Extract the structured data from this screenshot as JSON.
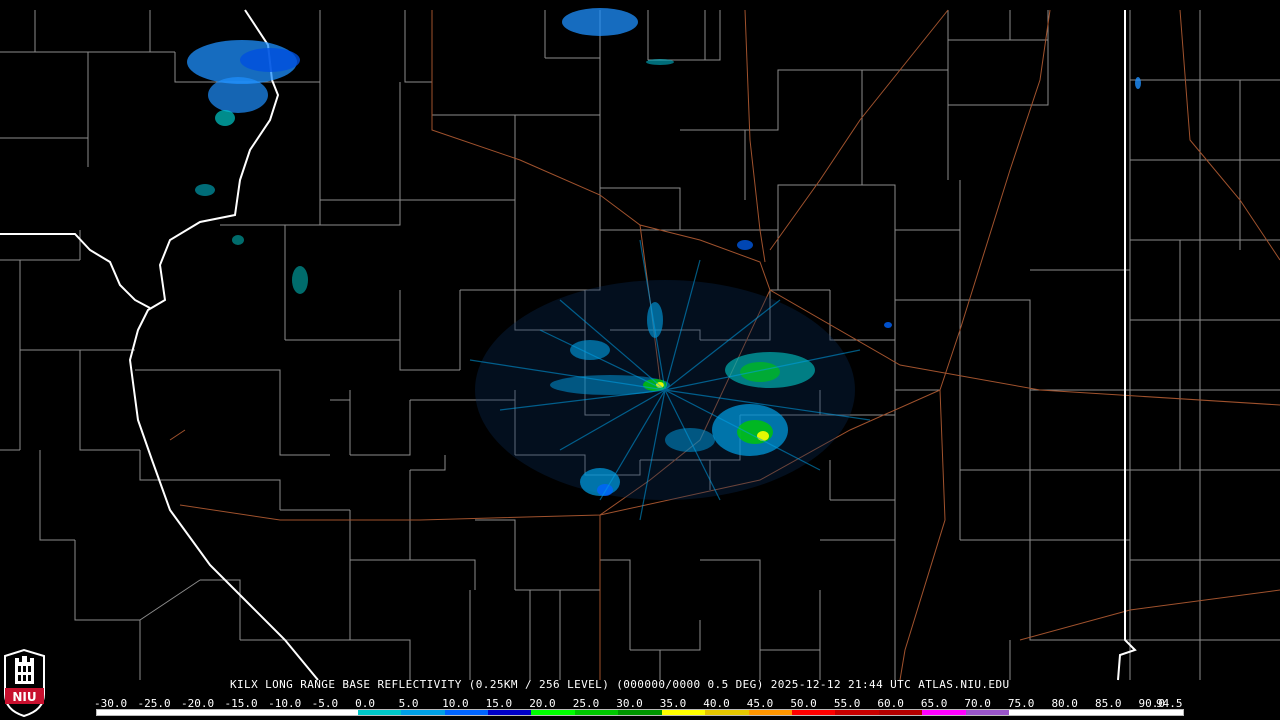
{
  "product": {
    "title": "KILX LONG RANGE BASE REFLECTIVITY (0.25KM / 256 LEVEL) (000000/0000 0.5 DEG) 2025-12-12 21:44 UTC  ATLAS.NIU.EDU"
  },
  "logo": {
    "text": "NIU",
    "color": "#c8102e"
  },
  "colors": {
    "background": "#000000",
    "county_lines": "#8c8c8c",
    "state_lines": "#ffffff",
    "highways": "#a0522d"
  },
  "scale": {
    "labels": [
      "-30.0",
      "-25.0",
      "-20.0",
      "-15.0",
      "-10.0",
      "-5.0",
      "0.0",
      "5.0",
      "10.0",
      "15.0",
      "20.0",
      "25.0",
      "30.0",
      "35.0",
      "40.0",
      "45.0",
      "50.0",
      "55.0",
      "60.0",
      "65.0",
      "70.0",
      "75.0",
      "80.0",
      "85.0",
      "90.0",
      "94.5"
    ],
    "colors": [
      "#ffffff",
      "#ffffff",
      "#ffffff",
      "#ffffff",
      "#ffffff",
      "#ffffff",
      "#00c8c8",
      "#00a0e6",
      "#0064ff",
      "#0000c8",
      "#00ff00",
      "#00c800",
      "#009600",
      "#ffff00",
      "#e6c800",
      "#ff9600",
      "#ff0000",
      "#c80000",
      "#b40000",
      "#ff00ff",
      "#9955c9",
      "#ffffff",
      "#ffffff",
      "#ffffff",
      "#ffffff"
    ]
  }
}
